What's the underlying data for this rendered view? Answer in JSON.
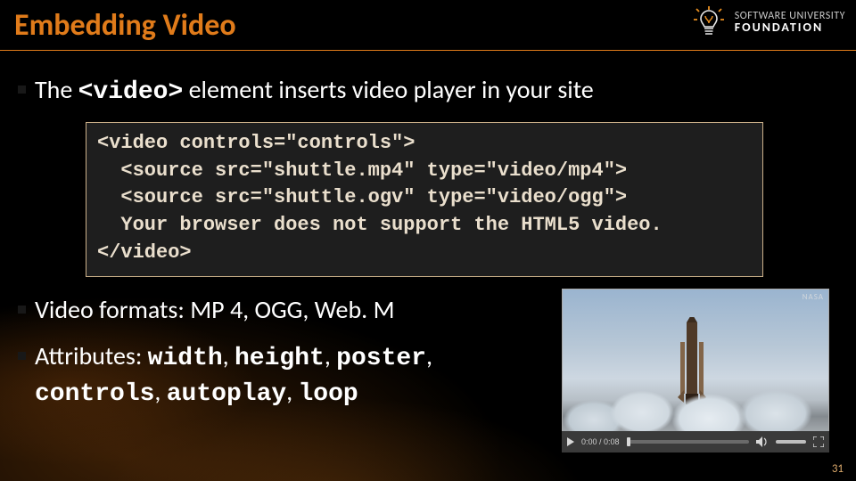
{
  "slide": {
    "title": "Embedding Video",
    "page_number": "31"
  },
  "logo": {
    "line1": "SOFTWARE UNIVERSITY",
    "line2": "FOUNDATION"
  },
  "bullets": {
    "intro_pre": "The ",
    "intro_tag": "<video>",
    "intro_post": " element inserts video player in your site",
    "formats_pre": "Video formats: ",
    "formats_list": "MP 4, OGG, Web. M",
    "attrs_pre": "Attributes: ",
    "attrs": {
      "a1": "width",
      "a2": "height",
      "a3": "poster",
      "a4": "controls",
      "a5": "autoplay",
      "a6": "loop"
    }
  },
  "code": {
    "l1": "<video controls=\"controls\">",
    "l2": "  <source src=\"shuttle.mp4\" type=\"video/mp4\">",
    "l3": "  <source src=\"shuttle.ogv\" type=\"video/ogg\">",
    "l4": "  Your browser does not support the HTML5 video.",
    "l5": "</video>"
  },
  "video_thumb": {
    "watermark": "NASA",
    "time": "0:00 / 0:08"
  }
}
